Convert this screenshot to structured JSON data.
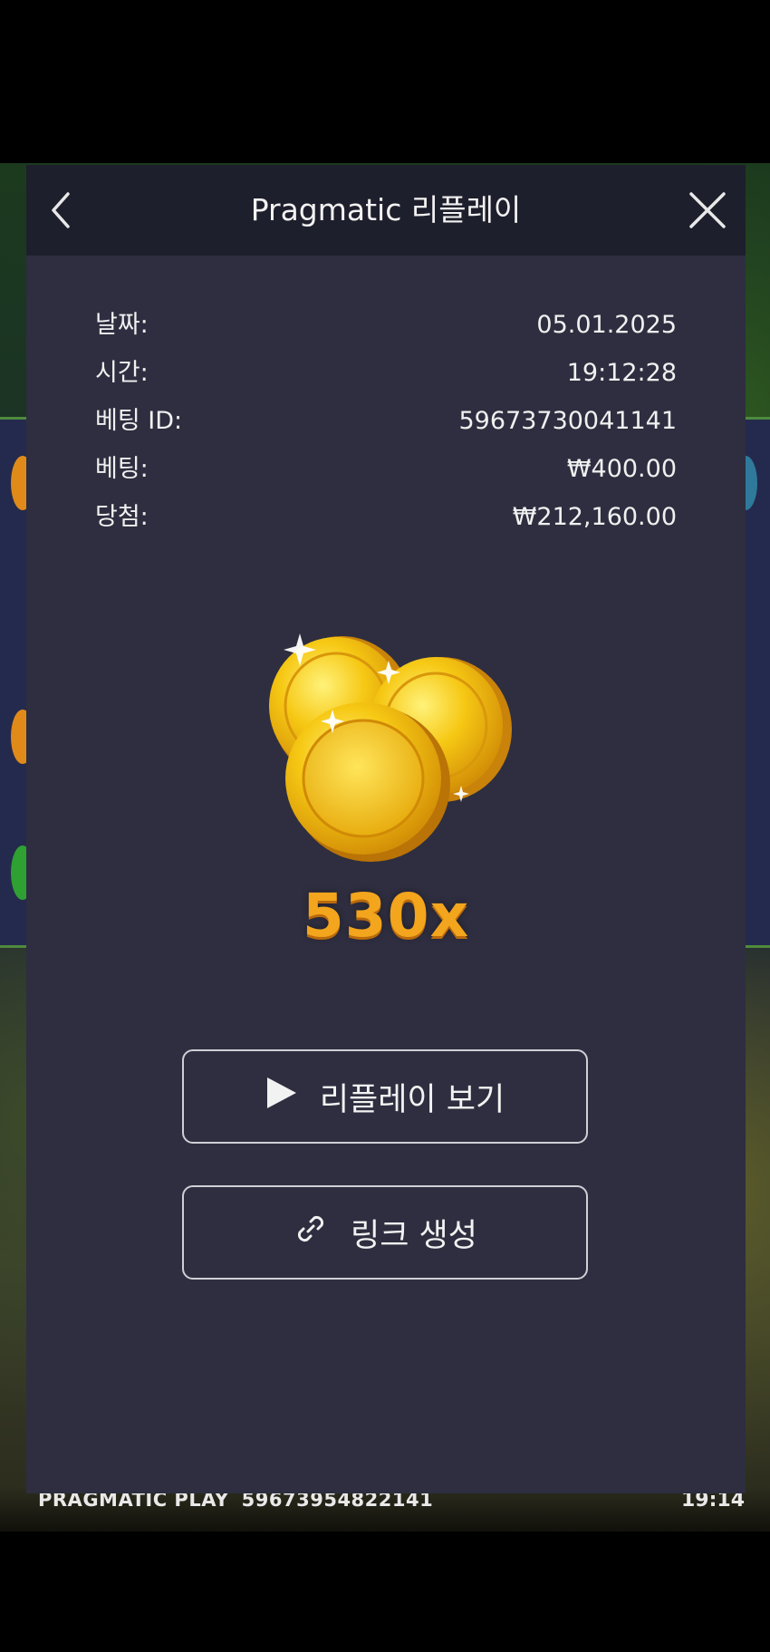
{
  "modal": {
    "title": "Pragmatic 리플레이",
    "details": [
      {
        "label": "날짜:",
        "value": "05.01.2025"
      },
      {
        "label": "시간:",
        "value": "19:12:28"
      },
      {
        "label": "베팅 ID:",
        "value": "59673730041141"
      },
      {
        "label": "베팅:",
        "value": "₩400.00"
      },
      {
        "label": "당첨:",
        "value": "₩212,160.00"
      }
    ],
    "multiplier": "530x",
    "replay_button": "리플레이 보기",
    "link_button": "링크 생성"
  },
  "background": {
    "brand": "PRAGMATIC PLAY",
    "round_id": "59673954822141",
    "time": "19:14"
  },
  "icons": {
    "back": "chevron-left-icon",
    "close": "close-icon",
    "play": "play-icon",
    "link": "link-icon",
    "coins": "gold-coins-icon"
  },
  "colors": {
    "modal_bg": "#2e2e40",
    "header_bg": "#1e1f2c",
    "multiplier": "#f2a51d",
    "text": "#f0f0f0"
  }
}
